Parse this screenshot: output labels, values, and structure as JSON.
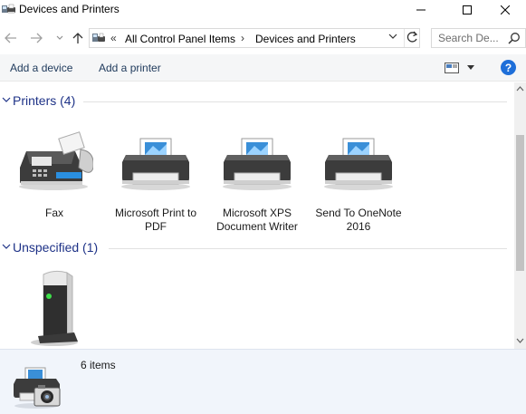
{
  "window": {
    "title": "Devices and Printers"
  },
  "navigation": {
    "breadcrumb_prefix": "«",
    "breadcrumbs": [
      "All Control Panel Items",
      "Devices and Printers"
    ],
    "separator": "›",
    "search_placeholder": "Search De..."
  },
  "commands": {
    "add_device": "Add a device",
    "add_printer": "Add a printer",
    "help": "?"
  },
  "groups": [
    {
      "label": "Printers (4)",
      "devices": [
        {
          "name": "Fax",
          "icon": "fax-icon"
        },
        {
          "name": "Microsoft Print to PDF",
          "icon": "printer-icon"
        },
        {
          "name": "Microsoft XPS Document Writer",
          "icon": "printer-icon"
        },
        {
          "name": "Send To OneNote 2016",
          "icon": "printer-icon"
        }
      ]
    },
    {
      "label": "Unspecified (1)",
      "devices": [
        {
          "name": "",
          "icon": "computer-tower-icon"
        }
      ]
    }
  ],
  "details": {
    "count": "6 items",
    "icon": "printer-camera-icon"
  },
  "colors": {
    "group_header": "#1e3287",
    "command_text": "#1e395b",
    "details_bg": "#f1f5fb",
    "help_blue": "#1e6fd9"
  }
}
